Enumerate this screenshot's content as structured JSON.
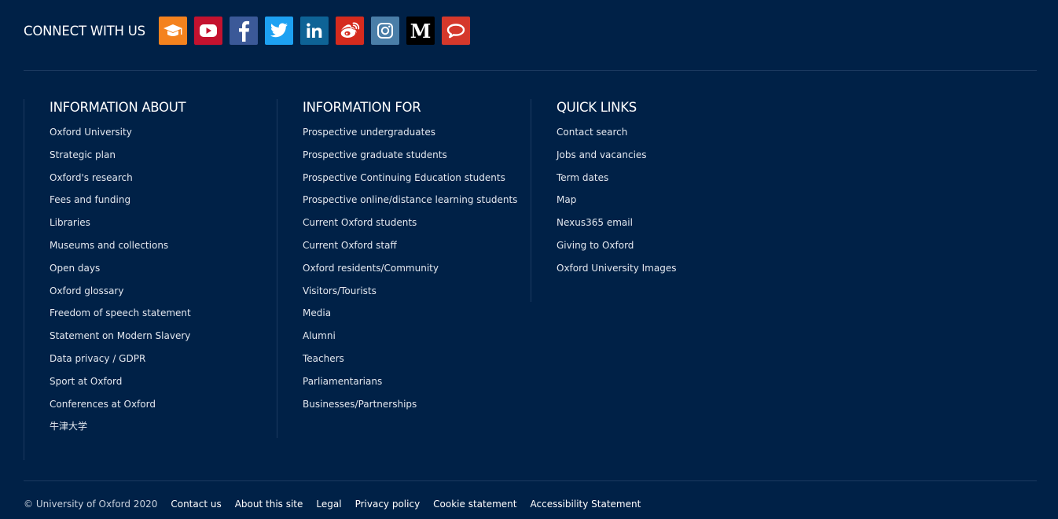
{
  "connect": {
    "title": "CONNECT WITH US",
    "icons": [
      {
        "name": "mortarboard-icon",
        "label": "Oxford Podcasts",
        "color": "#f4821e"
      },
      {
        "name": "youtube-icon",
        "label": "YouTube",
        "color": "#c4122f"
      },
      {
        "name": "facebook-icon",
        "label": "Facebook",
        "color": "#3b5998"
      },
      {
        "name": "twitter-icon",
        "label": "Twitter",
        "color": "#1da1f2"
      },
      {
        "name": "linkedin-icon",
        "label": "LinkedIn",
        "color": "#0e6396"
      },
      {
        "name": "weibo-icon",
        "label": "Weibo",
        "color": "#d52b1e"
      },
      {
        "name": "instagram-icon",
        "label": "Instagram",
        "color": "#4a7ea8"
      },
      {
        "name": "medium-icon",
        "label": "Medium",
        "color": "#000000"
      },
      {
        "name": "speech-bubble-icon",
        "label": "Oxford Chat",
        "color": "#d5382b"
      }
    ]
  },
  "columns": {
    "about": {
      "title": "INFORMATION ABOUT",
      "links": [
        "Oxford University",
        "Strategic plan",
        "Oxford's research",
        "Fees and funding",
        "Libraries",
        "Museums and collections",
        "Open days",
        "Oxford glossary",
        "Freedom of speech statement",
        "Statement on Modern Slavery",
        "Data privacy / GDPR",
        "Sport at Oxford",
        "Conferences at Oxford",
        "牛津大学"
      ]
    },
    "for": {
      "title": "INFORMATION FOR",
      "links": [
        "Prospective undergraduates",
        "Prospective graduate students",
        "Prospective Continuing Education students",
        "Prospective online/distance learning students",
        "Current Oxford students",
        "Current Oxford staff",
        "Oxford residents/Community",
        "Visitors/Tourists",
        "Media",
        "Alumni",
        "Teachers",
        "Parliamentarians",
        "Businesses/Partnerships"
      ]
    },
    "quick": {
      "title": "QUICK LINKS",
      "links": [
        "Contact search",
        "Jobs and vacancies",
        "Term dates",
        "Map",
        "Nexus365 email",
        "Giving to Oxford",
        "Oxford University Images"
      ]
    }
  },
  "footer": {
    "copyright": "© University of Oxford 2020",
    "links": [
      "Contact us",
      "About this site",
      "Legal",
      "Privacy policy",
      "Cookie statement",
      "Accessibility Statement"
    ]
  }
}
